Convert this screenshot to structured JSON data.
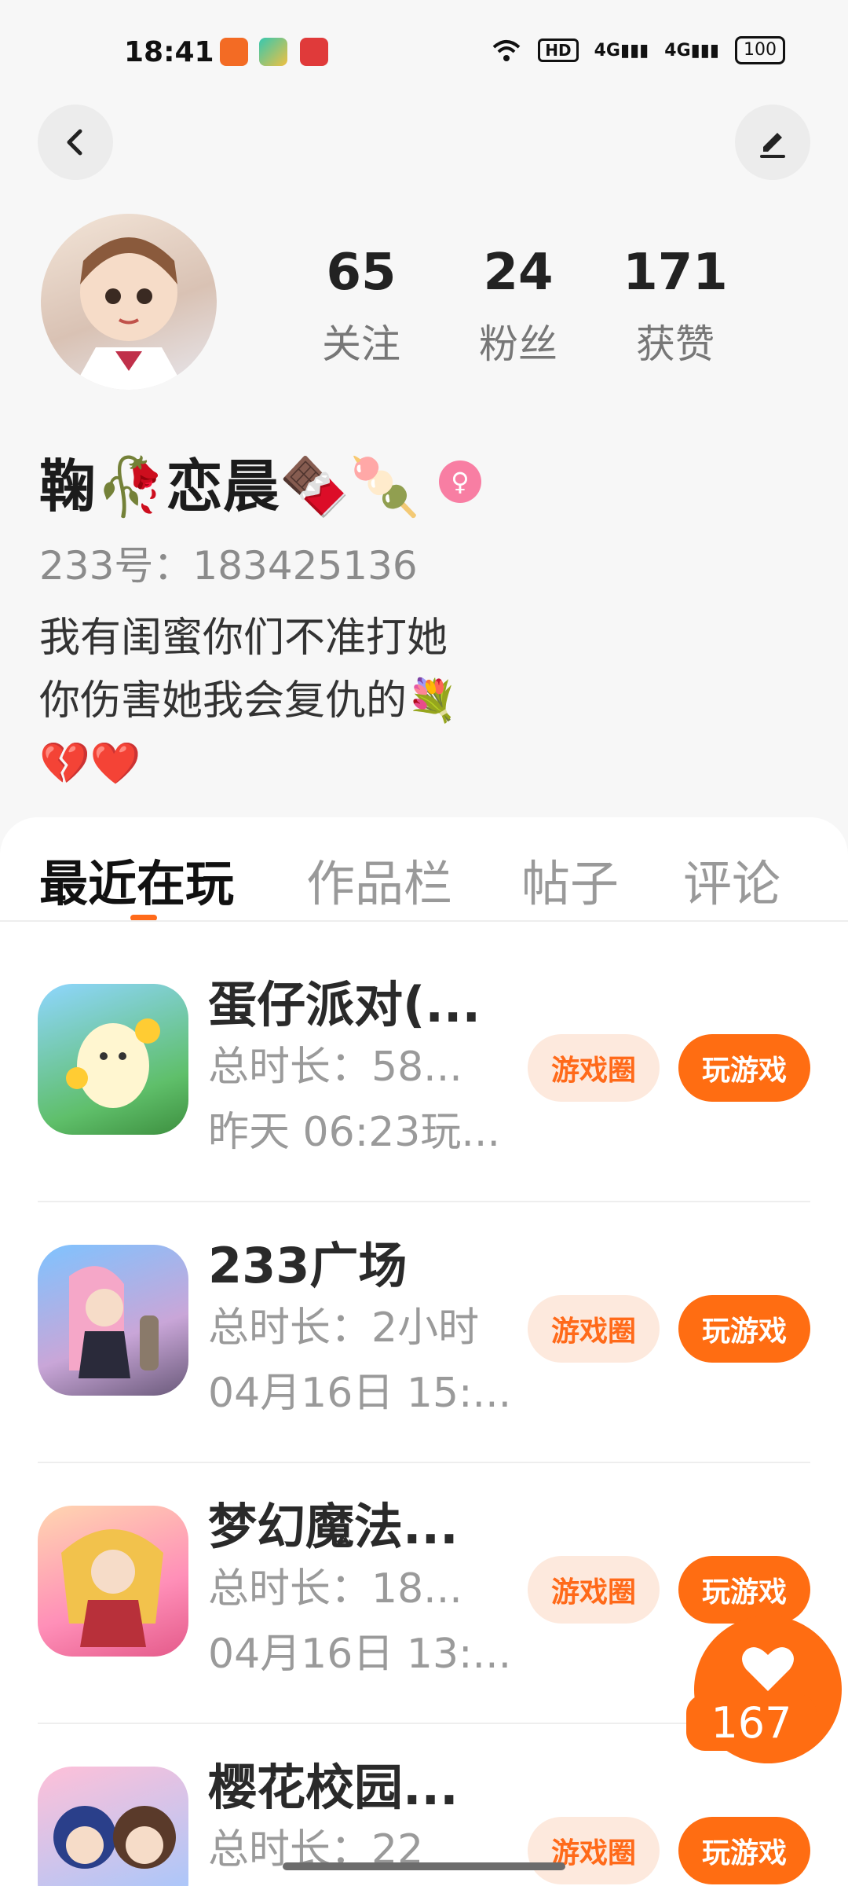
{
  "status_bar": {
    "time": "18:41",
    "hd_label": "HD",
    "net1": "4G",
    "net2": "4G",
    "battery": "100"
  },
  "profile": {
    "stats": [
      {
        "value": "65",
        "label": "关注"
      },
      {
        "value": "24",
        "label": "粉丝"
      },
      {
        "value": "171",
        "label": "获赞"
      }
    ],
    "username": "鞠🥀恋晨🍫🍡",
    "gender_symbol": "♀",
    "user_id": "233号：183425136",
    "bio_lines": [
      "我有闺蜜你们不准打她",
      "你伤害她我会复仇的💐",
      "💔❤️"
    ]
  },
  "tabs": [
    {
      "label": "最近在玩",
      "active": true
    },
    {
      "label": "作品栏",
      "active": false
    },
    {
      "label": "帖子",
      "active": false
    },
    {
      "label": "评论",
      "active": false
    }
  ],
  "games": [
    {
      "title": "蛋仔派对(...",
      "duration": "总时长：58...",
      "last_played": "昨天 06:23玩...",
      "circle_label": "游戏圈",
      "play_label": "玩游戏"
    },
    {
      "title": "233广场",
      "duration": "总时长：2小时",
      "last_played": "04月16日 15:...",
      "circle_label": "游戏圈",
      "play_label": "玩游戏"
    },
    {
      "title": "梦幻魔法...",
      "duration": "总时长：18...",
      "last_played": "04月16日 13:...",
      "circle_label": "游戏圈",
      "play_label": "玩游戏"
    },
    {
      "title": "樱花校园...",
      "duration": "总时长：22",
      "last_played": "",
      "circle_label": "游戏圈",
      "play_label": "玩游戏"
    }
  ],
  "like_count": "167",
  "colors": {
    "accent": "#ff6d12",
    "accent_light": "#fde9dd",
    "text_muted": "#9a9a9a"
  }
}
